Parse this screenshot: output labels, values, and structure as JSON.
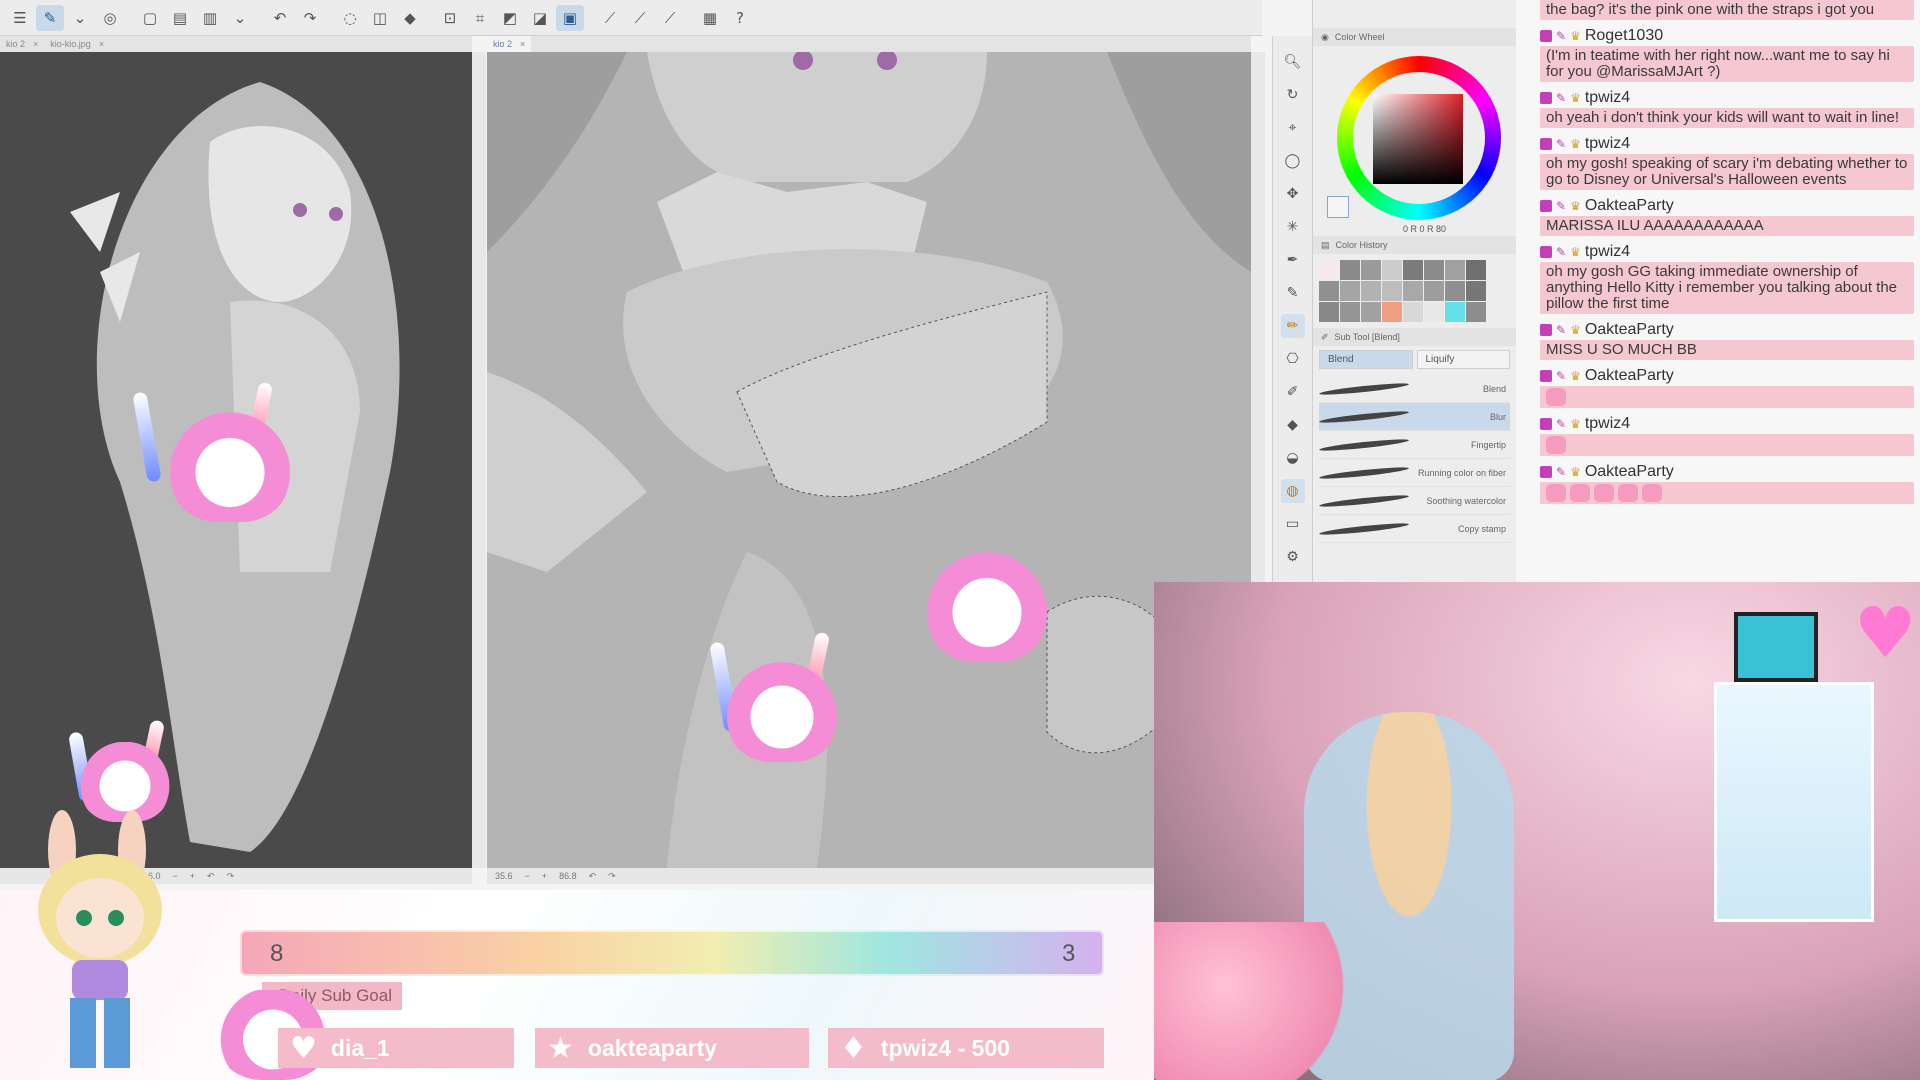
{
  "toolbar": {
    "buttons": [
      {
        "icon": "menu-icon",
        "glyph": "☰"
      },
      {
        "icon": "brush-settings-icon",
        "glyph": "✎",
        "active": true
      },
      {
        "icon": "chevron-down-icon",
        "glyph": "⌄"
      },
      {
        "icon": "companion-icon",
        "glyph": "◎"
      },
      {
        "icon": "new-file-icon",
        "glyph": "▢"
      },
      {
        "icon": "open-icon",
        "glyph": "▤"
      },
      {
        "icon": "save-icon",
        "glyph": "▥"
      },
      {
        "icon": "save-dropdown-icon",
        "glyph": "⌄"
      },
      {
        "icon": "undo-icon",
        "glyph": "↶"
      },
      {
        "icon": "redo-icon",
        "glyph": "↷"
      },
      {
        "icon": "deselect-icon",
        "glyph": "◌"
      },
      {
        "icon": "clear-icon",
        "glyph": "◫"
      },
      {
        "icon": "fill-icon",
        "glyph": "◆"
      },
      {
        "icon": "crop-icon",
        "glyph": "⊡"
      },
      {
        "icon": "transform-icon",
        "glyph": "⌗"
      },
      {
        "icon": "invert-selection-icon",
        "glyph": "◩"
      },
      {
        "icon": "selection-mode-icon",
        "glyph": "◪"
      },
      {
        "icon": "show-selection-icon",
        "glyph": "▣",
        "active": true
      },
      {
        "icon": "snap-ruler-icon",
        "glyph": "⟋"
      },
      {
        "icon": "snap-special-icon",
        "glyph": "⟋"
      },
      {
        "icon": "snap-grid-icon",
        "glyph": "⟋"
      },
      {
        "icon": "layer-property-icon",
        "glyph": "▦"
      },
      {
        "icon": "help-icon",
        "glyph": "?"
      }
    ]
  },
  "tabs_left": [
    {
      "label": "kio 2"
    },
    {
      "label": "kio-kio.jpg"
    }
  ],
  "tabs_main": [
    {
      "label": "kio 2"
    }
  ],
  "status_left": {
    "zoom": "6.0"
  },
  "status_main": {
    "zoom": "35.6",
    "angle": "86.8"
  },
  "tools": [
    {
      "icon": "zoom-icon",
      "glyph": "🔍︎"
    },
    {
      "icon": "rotate-icon",
      "glyph": "↻"
    },
    {
      "icon": "operation-icon",
      "glyph": "⌖"
    },
    {
      "icon": "lasso-icon",
      "glyph": "◯"
    },
    {
      "icon": "move-icon",
      "glyph": "✥"
    },
    {
      "icon": "magic-wand-icon",
      "glyph": "✳"
    },
    {
      "icon": "eyedropper-icon",
      "glyph": "✒"
    },
    {
      "icon": "pen-icon",
      "glyph": "✎"
    },
    {
      "icon": "pencil-icon",
      "glyph": "✏",
      "active": true
    },
    {
      "icon": "stamp-icon",
      "glyph": "⎔"
    },
    {
      "icon": "brush-icon",
      "glyph": "✐"
    },
    {
      "icon": "eraser-icon",
      "glyph": "◆"
    },
    {
      "icon": "fill-bucket-icon",
      "glyph": "◒"
    },
    {
      "icon": "blend-icon",
      "glyph": "◍",
      "active": true
    },
    {
      "icon": "figure-icon",
      "glyph": "▭"
    },
    {
      "icon": "settings-icon",
      "glyph": "⚙"
    }
  ],
  "color_wheel": {
    "title": "Color Wheel",
    "values": "0 R  0 R 80"
  },
  "color_history": {
    "title": "Color History",
    "swatches": [
      "#f5e9ec",
      "#8a8a8a",
      "#9a9a9a",
      "#cccccc",
      "#7b7b7b",
      "#8b8b8b",
      "#a0a0a0",
      "#6f6f6f",
      "#909090",
      "#a5a5a5",
      "#b2b2b2",
      "#bdbdbd",
      "#a8a8a8",
      "#9d9d9d",
      "#8f8f8f",
      "#777777",
      "#888888",
      "#959595",
      "#a1a1a1",
      "#f0a080",
      "#d8d8d8",
      "#e8e8e8",
      "#64e0e6",
      "#8d8d8d"
    ]
  },
  "sub_tool": {
    "title": "Sub Tool [Blend]",
    "tabs": [
      {
        "label": "Blend",
        "active": true
      },
      {
        "label": "Liquify"
      }
    ],
    "brushes": [
      {
        "label": "Blend"
      },
      {
        "label": "Blur",
        "active": true
      },
      {
        "label": "Fingertip"
      },
      {
        "label": "Running color on fiber"
      },
      {
        "label": "Soothing watercolor"
      },
      {
        "label": "Copy stamp"
      }
    ]
  },
  "chat": {
    "messages": [
      {
        "user": "",
        "text": "the bag? it's the pink one with the straps i got you"
      },
      {
        "user": "Roget1030",
        "text": "(I'm in teatime with her right now...want me to say hi for you @MarissaMJArt ?)"
      },
      {
        "user": "tpwiz4",
        "text": "oh yeah i don't think your kids will want to wait in line!"
      },
      {
        "user": "tpwiz4",
        "text": "oh my gosh! speaking of scary i'm debating whether to go to Disney or Universal's Halloween events"
      },
      {
        "user": "OakteaParty",
        "text": "MARISSA ILU AAAAAAAAAAAA"
      },
      {
        "user": "tpwiz4",
        "text": "oh my gosh GG taking immediate ownership of anything Hello Kitty i remember you talking about the pillow the first time"
      },
      {
        "user": "OakteaParty",
        "text": "MISS U SO MUCH BB"
      },
      {
        "user": "OakteaParty",
        "text": "",
        "emotes": 1
      },
      {
        "user": "tpwiz4",
        "text": "",
        "emotes": 1
      },
      {
        "user": "OakteaParty",
        "text": "",
        "emotes": 5
      }
    ],
    "colors": {
      "bubble": "#f4c7d1",
      "badge": "#c23fb5"
    }
  },
  "overlay": {
    "goal_current": "8",
    "goal_target": "3",
    "goal_label": "Daily Sub Goal",
    "recent": [
      {
        "icon": "heart-icon",
        "glyph": "♥",
        "label": "dia_1"
      },
      {
        "icon": "star-icon",
        "glyph": "★",
        "label": "oakteaparty"
      },
      {
        "icon": "diamond-icon",
        "glyph": "♦",
        "label": "tpwiz4 - 500"
      }
    ]
  }
}
